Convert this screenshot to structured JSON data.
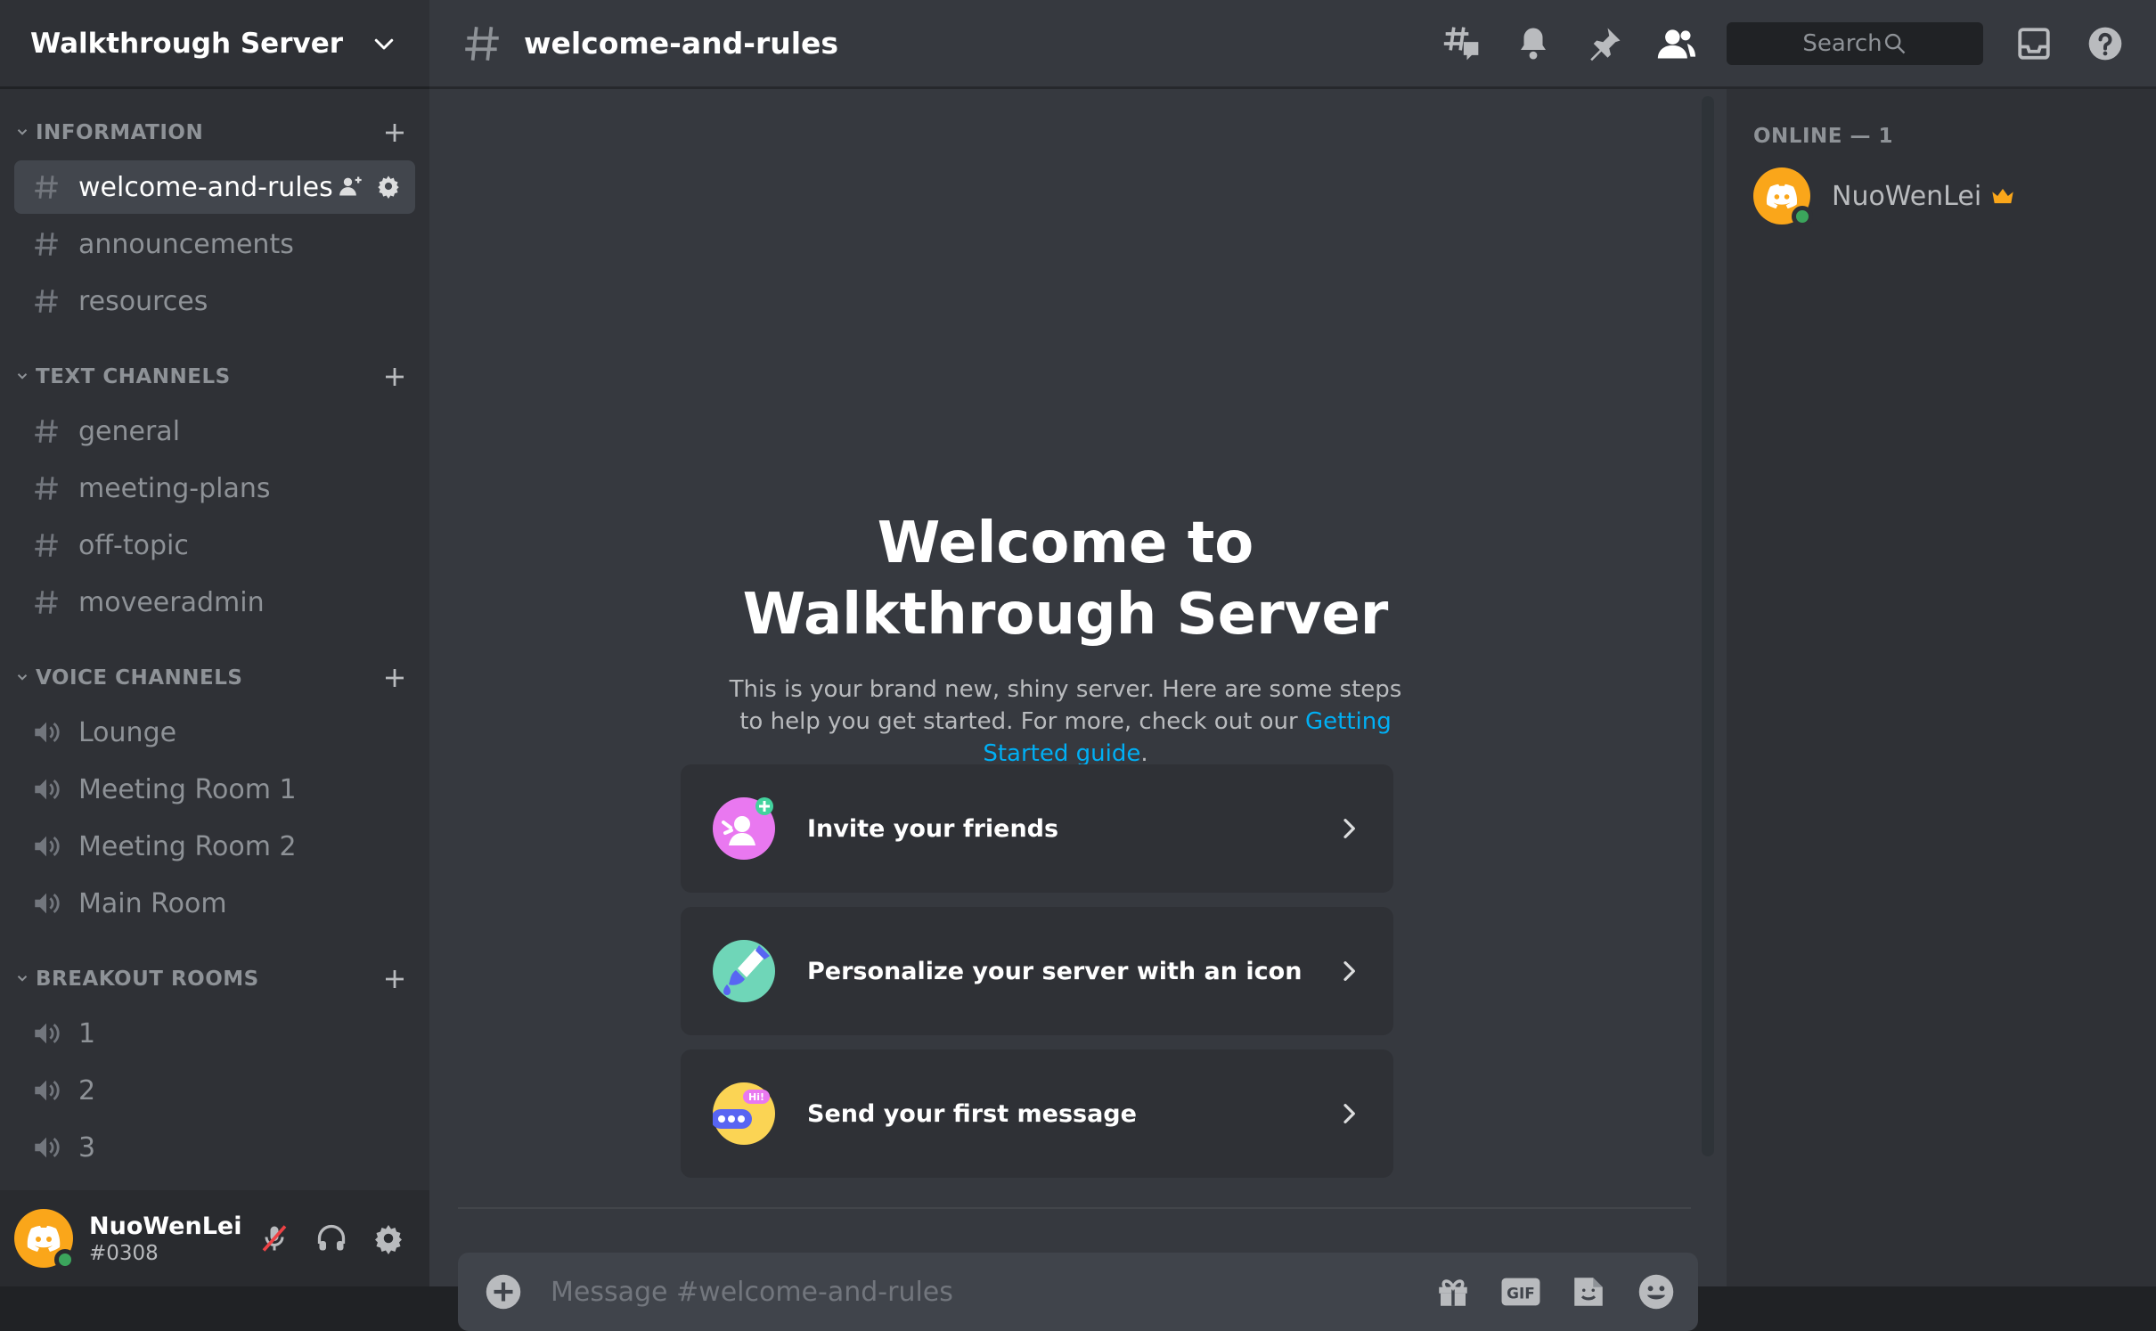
{
  "server": {
    "name": "Walkthrough Server"
  },
  "categories": [
    {
      "name": "INFORMATION",
      "channels": [
        {
          "name": "welcome-and-rules",
          "type": "text",
          "active": true
        },
        {
          "name": "announcements",
          "type": "text"
        },
        {
          "name": "resources",
          "type": "text"
        }
      ]
    },
    {
      "name": "TEXT CHANNELS",
      "channels": [
        {
          "name": "general",
          "type": "text"
        },
        {
          "name": "meeting-plans",
          "type": "text"
        },
        {
          "name": "off-topic",
          "type": "text"
        },
        {
          "name": "moveeradmin",
          "type": "text"
        }
      ]
    },
    {
      "name": "VOICE CHANNELS",
      "channels": [
        {
          "name": "Lounge",
          "type": "voice"
        },
        {
          "name": "Meeting Room 1",
          "type": "voice"
        },
        {
          "name": "Meeting Room 2",
          "type": "voice"
        },
        {
          "name": "Main Room",
          "type": "voice"
        }
      ]
    },
    {
      "name": "BREAKOUT ROOMS",
      "channels": [
        {
          "name": "1",
          "type": "voice"
        },
        {
          "name": "2",
          "type": "voice"
        },
        {
          "name": "3",
          "type": "voice"
        }
      ]
    }
  ],
  "user": {
    "name": "NuoWenLei",
    "tag": "#0308"
  },
  "topbar": {
    "channel": "welcome-and-rules",
    "search_placeholder": "Search"
  },
  "welcome": {
    "title_line1": "Welcome to",
    "title_line2": "Walkthrough Server",
    "desc_part1": "This is your brand new, shiny server. Here are some steps to help you get started. For more, check out our ",
    "link": "Getting Started guide",
    "desc_part2": "."
  },
  "cards": [
    {
      "label": "Invite your friends",
      "icon": "invite-icon"
    },
    {
      "label": "Personalize your server with an icon",
      "icon": "paintbrush-icon"
    },
    {
      "label": "Send your first message",
      "icon": "message-icon"
    }
  ],
  "composer": {
    "placeholder": "Message #welcome-and-rules"
  },
  "members": {
    "header": "ONLINE — 1",
    "list": [
      {
        "name": "NuoWenLei",
        "owner": true
      }
    ]
  },
  "colors": {
    "accent": "#5865f2",
    "online": "#3ba55c",
    "link": "#00aff4",
    "avatar": "#faa61a"
  }
}
